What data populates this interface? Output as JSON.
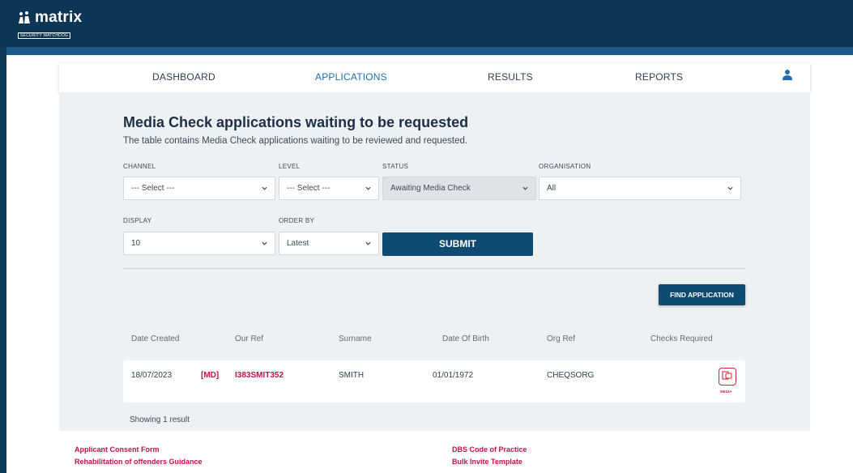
{
  "brand": {
    "name": "matrix",
    "tagline": "SECURITY WATCHDOG"
  },
  "nav": {
    "items": [
      {
        "label": "DASHBOARD",
        "active": false
      },
      {
        "label": "APPLICATIONS",
        "active": true
      },
      {
        "label": "RESULTS",
        "active": false
      },
      {
        "label": "REPORTS",
        "active": false
      }
    ],
    "user_icon": "user-icon"
  },
  "page": {
    "title": "Media Check applications waiting to be requested",
    "subtitle": "The table contains Media Check applications waiting to be reviewed and requested."
  },
  "filters": {
    "channel": {
      "label": "CHANNEL",
      "value": "--- Select ---"
    },
    "level": {
      "label": "LEVEL",
      "value": "--- Select ---"
    },
    "status": {
      "label": "STATUS",
      "value": "Awaiting Media Check"
    },
    "organisation": {
      "label": "ORGANISATION",
      "value": "All"
    },
    "display": {
      "label": "DISPLAY",
      "value": "10"
    },
    "order_by": {
      "label": "ORDER BY",
      "value": "Latest"
    },
    "submit_label": "SUBMIT"
  },
  "find_application_label": "FIND APPLICATION",
  "table": {
    "headers": [
      "Date Created",
      "Our Ref",
      "Surname",
      "Date Of Birth",
      "Org Ref",
      "Checks Required"
    ],
    "rows": [
      {
        "date_created": "18/07/2023",
        "tag": "[MD]",
        "our_ref": "I383SMIT352",
        "surname": "SMITH",
        "dob": "01/01/1972",
        "org_ref": "CHEQSORG",
        "check_label": "MEDIA"
      }
    ],
    "footer": "Showing 1 result"
  },
  "footer_links": {
    "left": [
      "Applicant Consent Form",
      "Rehabilitation of offenders Guidance"
    ],
    "right": [
      "DBS Code of Practice",
      "Bulk Invite Template"
    ]
  },
  "colors": {
    "header_bg": "#0c3556",
    "primary_button": "#0f4a72",
    "accent_link": "#c0114d",
    "active_nav": "#1f6eb5",
    "media_icon": "#d02a3b"
  }
}
